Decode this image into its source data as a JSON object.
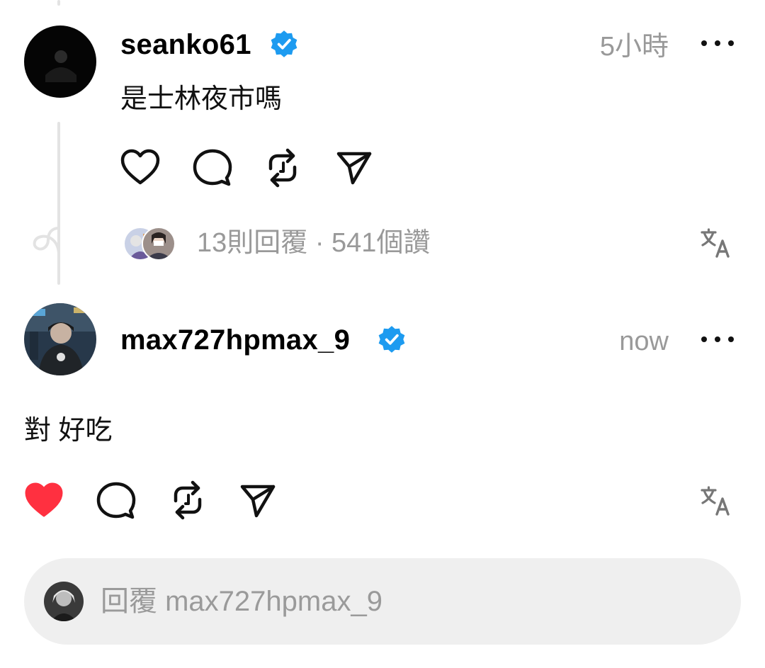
{
  "post1": {
    "username": "seanko61",
    "time": "5小時",
    "text": "是士林夜市嗎",
    "stats": "13則回覆 · 541個讚"
  },
  "post2": {
    "username": "max727hpmax_9",
    "time": "now",
    "text": "對 好吃",
    "liked": true
  },
  "reply": {
    "placeholder": "回覆 max727hpmax_9"
  },
  "colors": {
    "verified": "#1d9bf0",
    "like": "#ff3040",
    "muted": "#999999",
    "reply_bg": "#efefef"
  },
  "icons": {
    "like": "heart-icon",
    "comment": "comment-bubble-icon",
    "repost": "repost-icon",
    "share": "send-icon",
    "translate": "translate-icon",
    "more": "more-dots-icon"
  }
}
